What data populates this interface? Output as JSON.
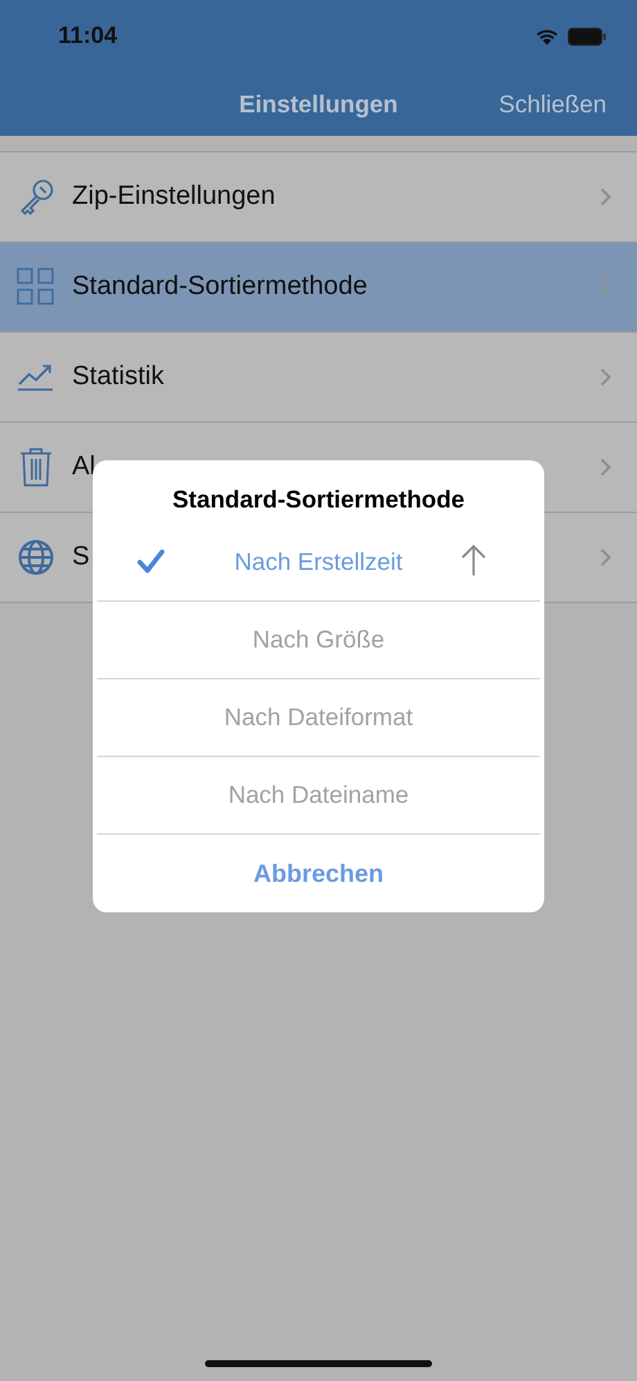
{
  "status_bar": {
    "time": "11:04"
  },
  "nav_bar": {
    "title": "Einstellungen",
    "close": "Schließen"
  },
  "settings": [
    {
      "kind": "key",
      "label": "Zip-Einstellungen",
      "selected": false
    },
    {
      "kind": "grid",
      "label": "Standard-Sortiermethode",
      "selected": true
    },
    {
      "kind": "chart",
      "label": "Statistik",
      "selected": false
    },
    {
      "kind": "trash",
      "label": "Al",
      "selected": false
    },
    {
      "kind": "globe",
      "label": "S",
      "selected": false
    }
  ],
  "dialog": {
    "title": "Standard-Sortiermethode",
    "options": [
      {
        "label": "Nach Erstellzeit",
        "selected": true
      },
      {
        "label": "Nach Größe",
        "selected": false
      },
      {
        "label": "Nach Dateiformat",
        "selected": false
      },
      {
        "label": "Nach Dateiname",
        "selected": false
      }
    ],
    "cancel": "Abbrechen"
  }
}
